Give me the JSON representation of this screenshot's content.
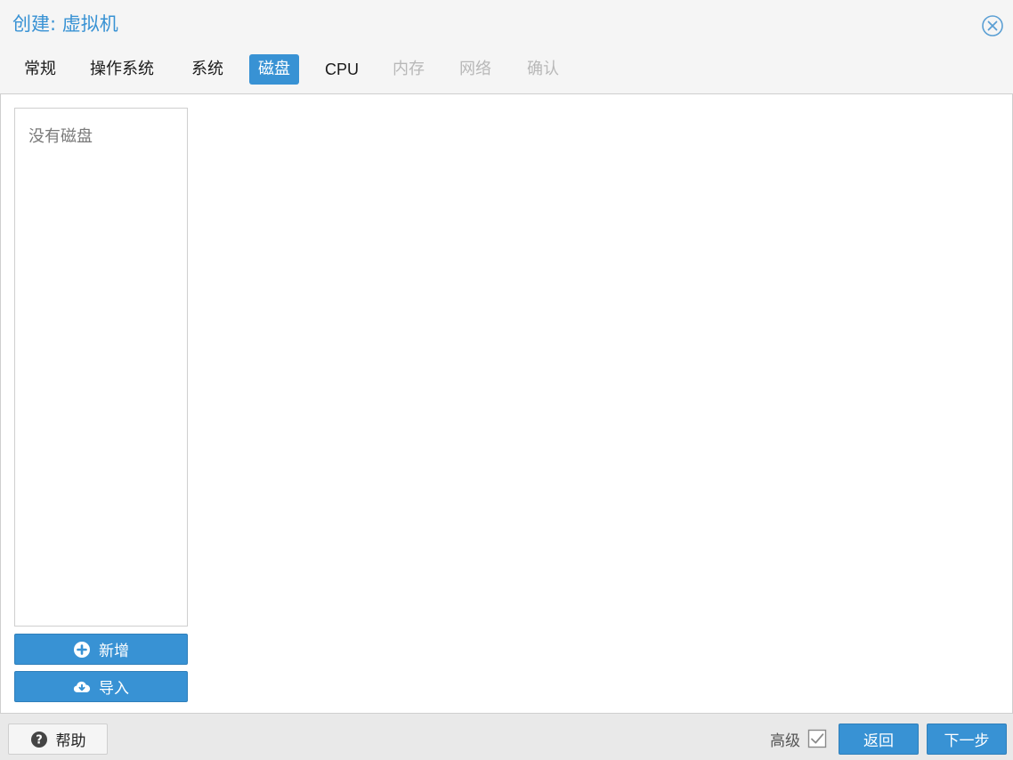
{
  "window": {
    "title": "创建: 虚拟机",
    "close_icon": "close-circle-icon"
  },
  "tabs": [
    {
      "label": "常规",
      "state": "normal"
    },
    {
      "label": "操作系统",
      "state": "normal"
    },
    {
      "label": "系统",
      "state": "normal"
    },
    {
      "label": "磁盘",
      "state": "active"
    },
    {
      "label": "CPU",
      "state": "normal"
    },
    {
      "label": "内存",
      "state": "disabled"
    },
    {
      "label": "网络",
      "state": "disabled"
    },
    {
      "label": "确认",
      "state": "disabled"
    }
  ],
  "disks": {
    "empty_text": "没有磁盘",
    "add_label": "新增",
    "add_icon": "plus-circle-icon",
    "import_label": "导入",
    "import_icon": "cloud-download-icon"
  },
  "footer": {
    "help_label": "帮助",
    "help_icon": "question-circle-icon",
    "advanced_label": "高级",
    "advanced_checked": true,
    "back_label": "返回",
    "next_label": "下一步"
  },
  "colors": {
    "accent": "#3892d4",
    "disabled_text": "#b8b8b8"
  }
}
